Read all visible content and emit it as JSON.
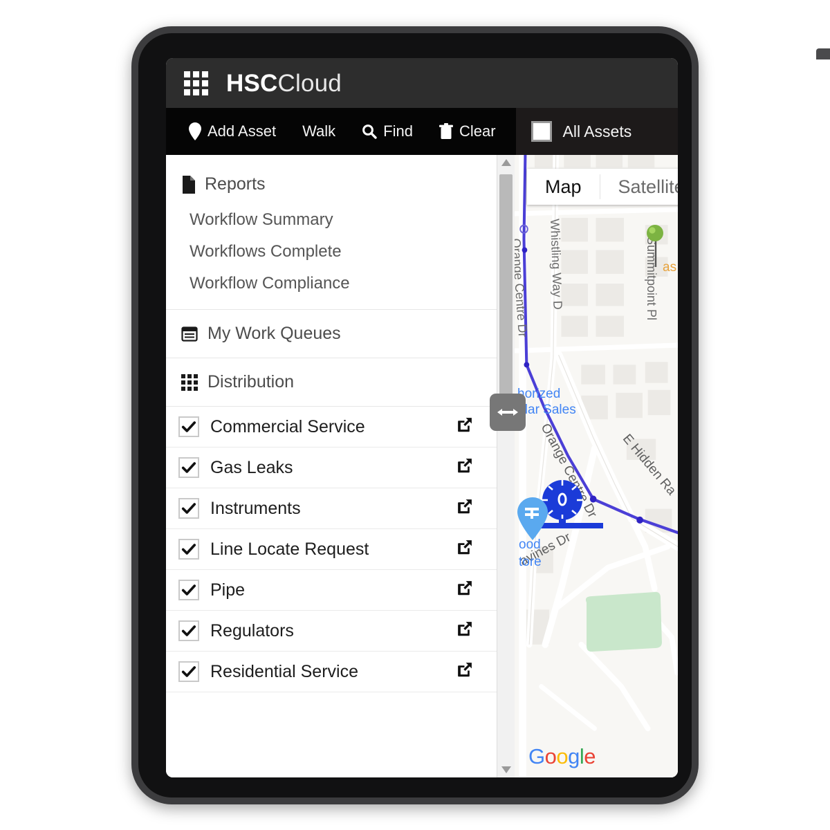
{
  "app": {
    "brand_bold": "HSC",
    "brand_light": "Cloud",
    "apps_icon": "grid-apps-icon"
  },
  "toolbar": {
    "buttons": [
      {
        "label": "Add Asset",
        "icon": "map-pin-icon"
      },
      {
        "label": "Walk",
        "icon": "none"
      },
      {
        "label": "Find",
        "icon": "search-icon"
      },
      {
        "label": "Clear",
        "icon": "trash-icon"
      }
    ],
    "all_assets": {
      "label": "All Assets",
      "checked": false,
      "icon": "checkbox-icon"
    }
  },
  "sidebar": {
    "reports": {
      "title": "Reports",
      "icon": "document-icon",
      "links": [
        "Workflow Summary",
        "Workflows Complete",
        "Workflow Compliance"
      ]
    },
    "work_queues": {
      "title": "My Work Queues",
      "icon": "calendar-list-icon"
    },
    "distribution": {
      "title": "Distribution",
      "icon": "grid-apps-icon"
    },
    "layers": [
      {
        "name": "Commercial Service",
        "checked": true
      },
      {
        "name": "Gas Leaks",
        "checked": true
      },
      {
        "name": "Instruments",
        "checked": true
      },
      {
        "name": "Line Locate Request",
        "checked": true
      },
      {
        "name": "Pipe",
        "checked": true
      },
      {
        "name": "Regulators",
        "checked": true
      },
      {
        "name": "Residential Service",
        "checked": true
      }
    ],
    "scrollbar": {
      "up_icon": "caret-up-icon",
      "down_icon": "caret-down-icon"
    },
    "splitter": {
      "icon": "resize-horizontal-icon"
    }
  },
  "map": {
    "type_buttons": [
      {
        "label": "Map",
        "active": true
      },
      {
        "label": "Satellite",
        "active": false
      }
    ],
    "attribution": {
      "text": "Google",
      "letters": [
        "G",
        "o",
        "o",
        "g",
        "l",
        "e"
      ]
    },
    "street_labels": [
      "Orange Centre Dr",
      "Whistling Way D",
      "Summitpoint Pl",
      "Orange Centre Dr",
      "E Hidden Ra",
      "avines Dr"
    ],
    "poi_labels": [
      "horized",
      "lular Sales",
      "ood",
      "tore",
      "as"
    ],
    "markers": [
      {
        "type": "green-pin-marker"
      },
      {
        "type": "regulator-cluster-marker"
      },
      {
        "type": "poi-pin-marker"
      }
    ],
    "colors": {
      "route": "#4b3fd6",
      "park": "#c8e6c9",
      "green_pin": "#8bc34a",
      "blue_marker": "#1b3bd8"
    }
  }
}
